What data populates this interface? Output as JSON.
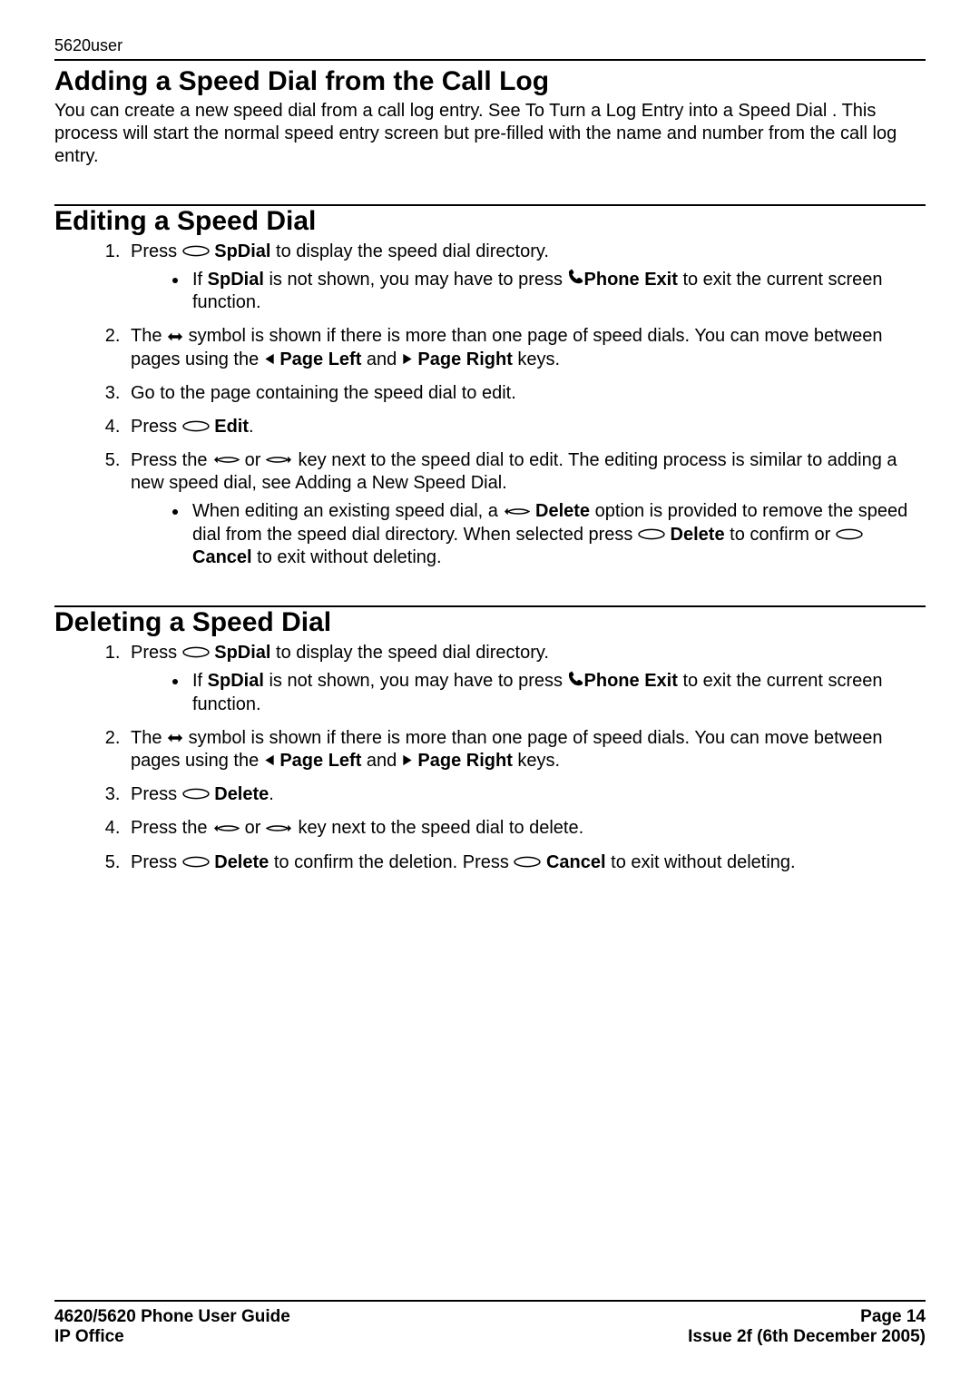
{
  "header": {
    "doc_tag": "5620user"
  },
  "sections": {
    "adding": {
      "title": "Adding a Speed Dial from the Call Log",
      "intro": "You can create a new speed dial from a call log entry. See To Turn a Log Entry into a Speed Dial . This process will start the normal speed entry screen but pre-filled with the name and number from the call log entry."
    },
    "editing": {
      "title": "Editing a Speed Dial",
      "step1_a": "Press ",
      "step1_b": " SpDial",
      "step1_c": " to display the speed dial directory.",
      "step1_sub_a": "If ",
      "step1_sub_b": "SpDial",
      "step1_sub_c": " is not shown, you may have to press ",
      "step1_sub_d": "Phone Exit",
      "step1_sub_e": " to exit the current screen function.",
      "step2_a": "The ",
      "step2_b": " symbol is shown if there is more than one page of speed dials. You can move between pages using the ",
      "step2_c": " Page Left",
      "step2_d": " and ",
      "step2_e": " Page Right",
      "step2_f": " keys.",
      "step3": "Go to the page containing the speed dial to edit.",
      "step4_a": "Press ",
      "step4_b": " Edit",
      "step4_c": ".",
      "step5_a": "Press the ",
      "step5_b": " or ",
      "step5_c": " key next to the speed dial to edit. The editing process is similar to adding a new speed dial, see Adding a New Speed Dial.",
      "step5_sub_a": "When editing an existing speed dial, a ",
      "step5_sub_b": " Delete",
      "step5_sub_c": " option is provided to remove the speed dial from the speed dial directory. When selected press ",
      "step5_sub_d": " Delete",
      "step5_sub_e": " to confirm or ",
      "step5_sub_f": " Cancel",
      "step5_sub_g": " to exit without deleting."
    },
    "deleting": {
      "title": "Deleting a Speed Dial",
      "step1_a": "Press ",
      "step1_b": " SpDial",
      "step1_c": " to display the speed dial directory.",
      "step1_sub_a": "If ",
      "step1_sub_b": "SpDial",
      "step1_sub_c": " is not shown, you may have to press ",
      "step1_sub_d": "Phone Exit",
      "step1_sub_e": " to exit the current screen function.",
      "step2_a": "The ",
      "step2_b": " symbol is shown if there is more than one page of speed dials. You can move between pages using the ",
      "step2_c": " Page Left",
      "step2_d": " and ",
      "step2_e": " Page Right",
      "step2_f": " keys.",
      "step3_a": "Press ",
      "step3_b": " Delete",
      "step3_c": ".",
      "step4_a": "Press the ",
      "step4_b": " or ",
      "step4_c": " key next to the speed dial to delete.",
      "step5_a": "Press ",
      "step5_b": " Delete",
      "step5_c": " to confirm the deletion. Press ",
      "step5_d": " Cancel",
      "step5_e": " to exit without deleting."
    }
  },
  "footer": {
    "left1": "4620/5620 Phone User Guide",
    "left2": "IP Office",
    "right1": "Page 14",
    "right2": "Issue 2f (6th December 2005)"
  }
}
